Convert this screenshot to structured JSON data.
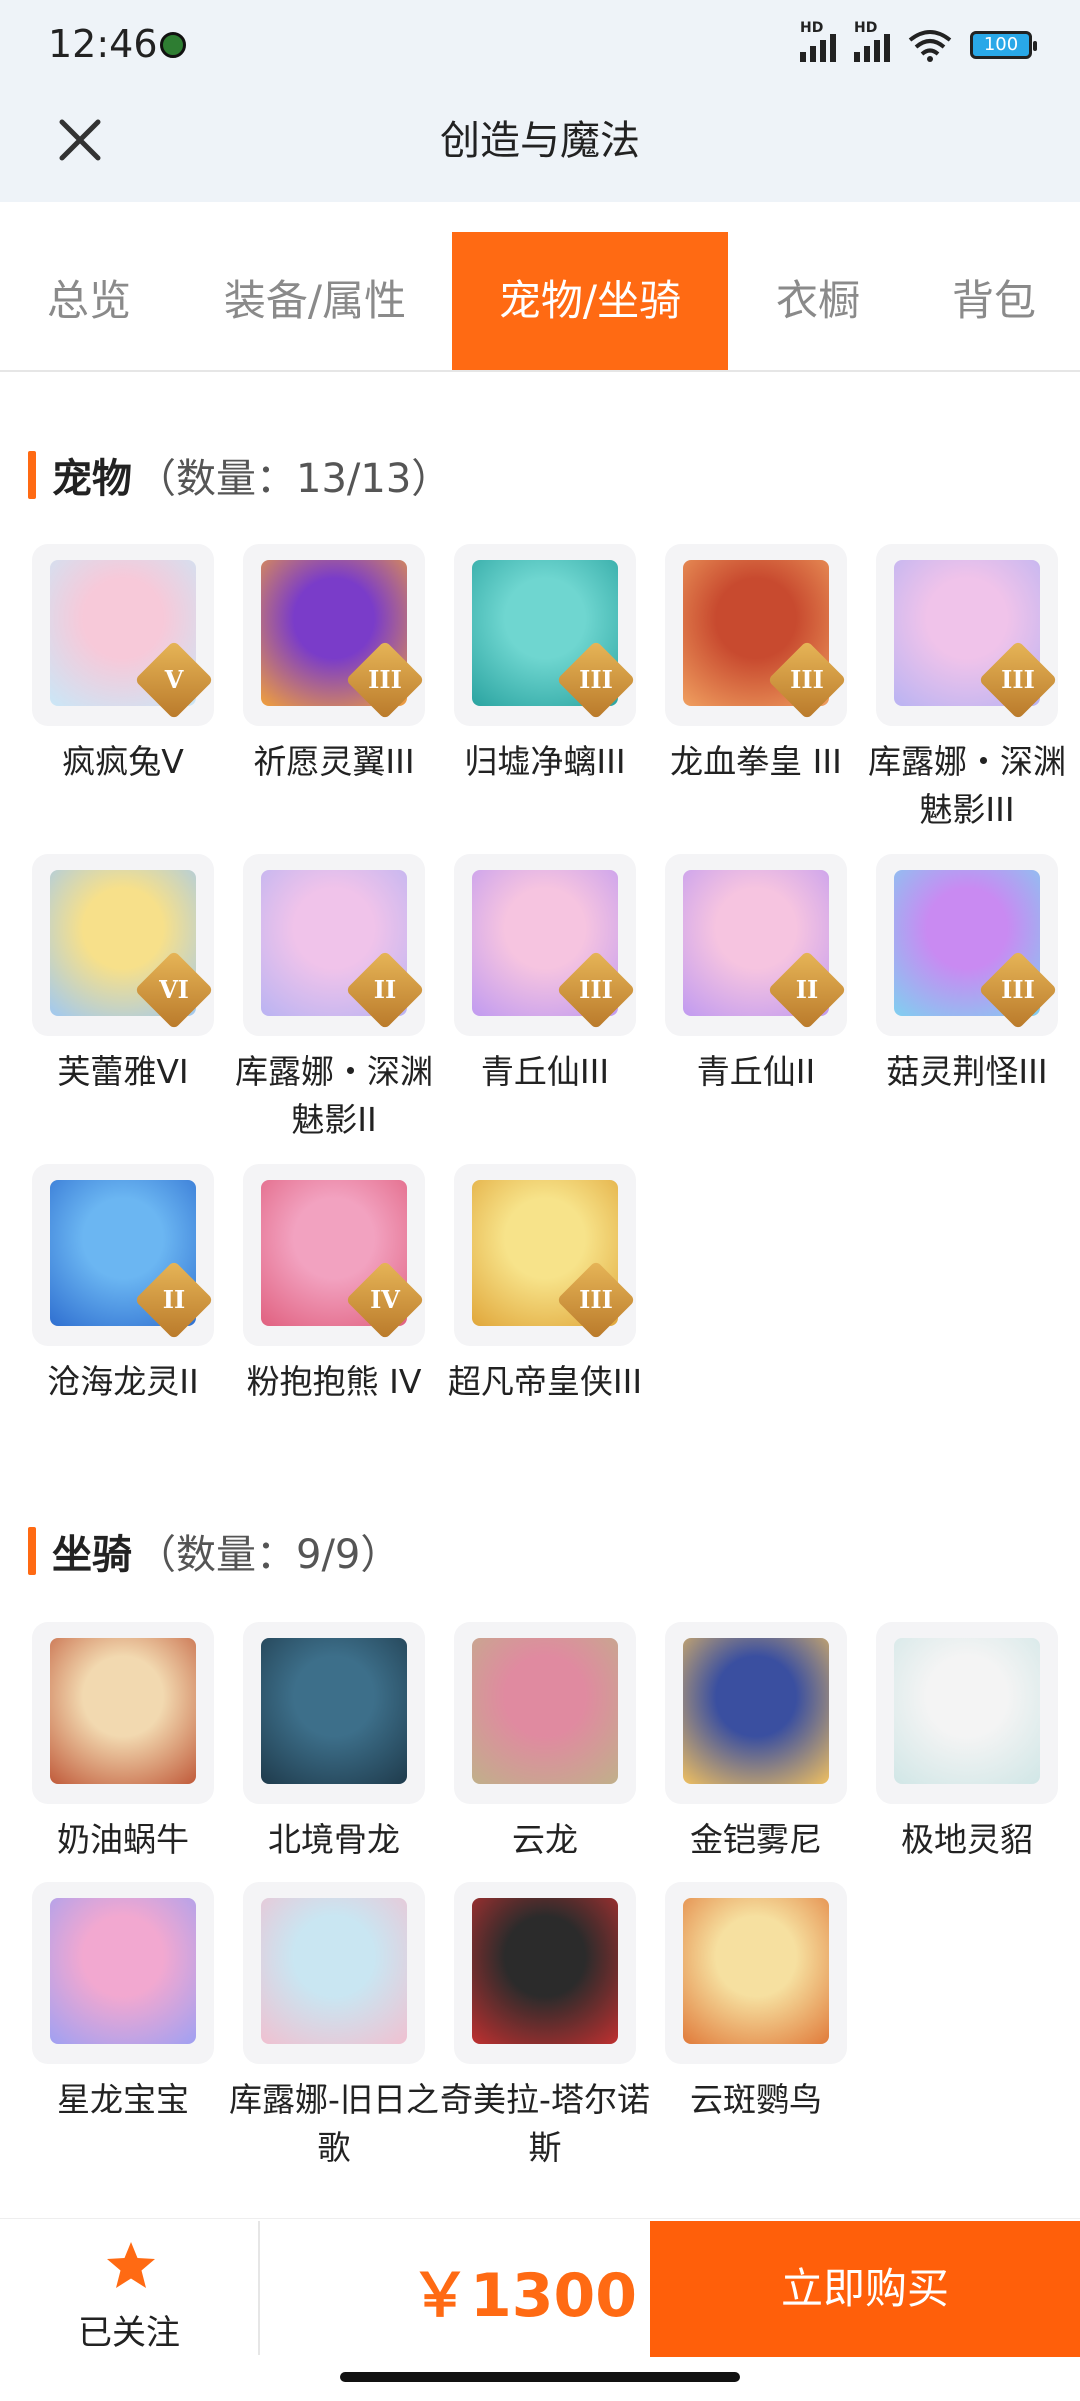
{
  "status_bar": {
    "time": "12:46",
    "signal_tag": "HD",
    "battery": "100"
  },
  "header": {
    "title": "创造与魔法"
  },
  "tabs": [
    {
      "label": "总览",
      "active": false
    },
    {
      "label": "装备/属性",
      "active": false
    },
    {
      "label": "宠物/坐骑",
      "active": true
    },
    {
      "label": "衣橱",
      "active": false
    },
    {
      "label": "背包",
      "active": false
    }
  ],
  "pets": {
    "title": "宠物",
    "count": "（数量：13/13）",
    "items": [
      {
        "name": "疯疯兔V",
        "rank": "V"
      },
      {
        "name": "祈愿灵翼III",
        "rank": "III"
      },
      {
        "name": "归墟净螭III",
        "rank": "III"
      },
      {
        "name": "龙血拳皇 III",
        "rank": "III"
      },
      {
        "name": "库露娜・深渊魅影III",
        "rank": "III"
      },
      {
        "name": "芙蕾雅VI",
        "rank": "VI"
      },
      {
        "name": "库露娜・深渊魅影II",
        "rank": "II"
      },
      {
        "name": "青丘仙III",
        "rank": "III"
      },
      {
        "name": "青丘仙II",
        "rank": "II"
      },
      {
        "name": "菇灵荆怪III",
        "rank": "III"
      },
      {
        "name": "沧海龙灵II",
        "rank": "II"
      },
      {
        "name": "粉抱抱熊 IV",
        "rank": "IV"
      },
      {
        "name": "超凡帝皇侠III",
        "rank": "III"
      }
    ]
  },
  "mounts": {
    "title": "坐骑",
    "count": "（数量：9/9）",
    "items": [
      {
        "name": "奶油蜗牛"
      },
      {
        "name": "北境骨龙"
      },
      {
        "name": "云龙"
      },
      {
        "name": "金铠雾尼"
      },
      {
        "name": "极地灵貂"
      },
      {
        "name": "星龙宝宝"
      },
      {
        "name": "库露娜-旧日之歌"
      },
      {
        "name": "奇美拉-塔尔诺斯"
      },
      {
        "name": "云斑鹦鸟"
      }
    ]
  },
  "bottom": {
    "follow_label": "已关注",
    "price": "￥1300",
    "buy_label": "立即购买"
  },
  "colors": {
    "accent": "#ff6a13",
    "header_bg": "#eef3f8",
    "tile_bg": "#f4f4f6"
  }
}
